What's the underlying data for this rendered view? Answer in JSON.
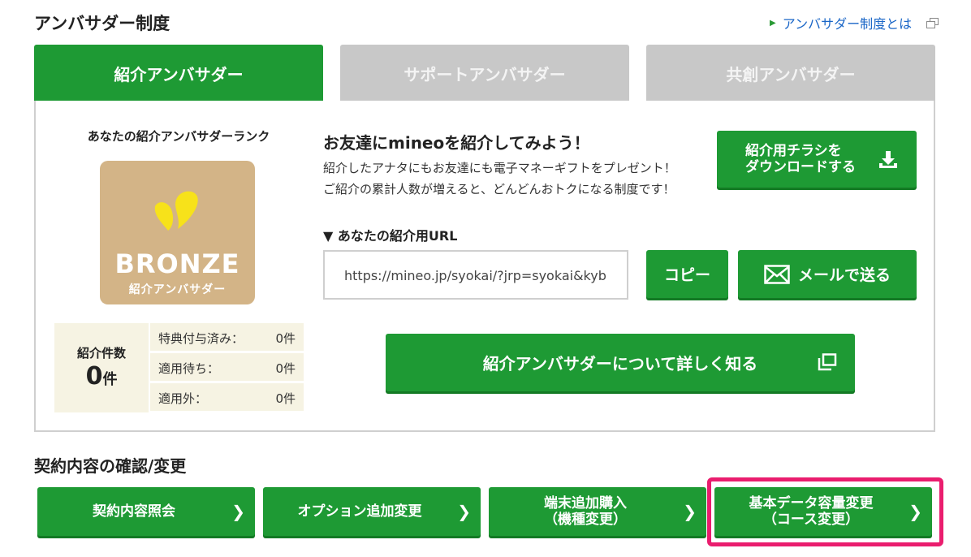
{
  "ambassador": {
    "title": "アンバサダー制度",
    "about_link": "アンバサダー制度とは",
    "tabs": [
      "紹介アンバサダー",
      "サポートアンバサダー",
      "共創アンバサダー"
    ],
    "rank_heading": "あなたの紹介アンバサダーランク",
    "rank_name": "BRONZE",
    "rank_sub": "紹介アンバサダー",
    "count_label": "紹介件数",
    "count_value": "0",
    "count_unit": "件",
    "stats": [
      {
        "label": "特典付与済み：",
        "value": "0件"
      },
      {
        "label": "適用待ち：",
        "value": "0件"
      },
      {
        "label": "適用外：",
        "value": "0件"
      }
    ],
    "promo_heading": "お友達にmineoを紹介してみよう！",
    "promo_line1": "紹介したアナタにもお友達にも電子マネーギフトをプレゼント！",
    "promo_line2": "ご紹介の累計人数が増えると、どんどんおトクになる制度です！",
    "flyer_button_line1": "紹介用チラシを",
    "flyer_button_line2": "ダウンロードする",
    "url_label": "▼ あなたの紹介用URL",
    "url_value": "https://mineo.jp/syokai/?jrp=syokai&kyb",
    "copy_button": "コピー",
    "mail_button": "メールで送る",
    "learn_more_button": "紹介アンバサダーについて詳しく知る"
  },
  "contract": {
    "title": "契約内容の確認/変更",
    "buttons": [
      {
        "line1": "契約内容照会",
        "line2": ""
      },
      {
        "line1": "オプション追加変更",
        "line2": ""
      },
      {
        "line1": "端末追加購入",
        "line2": "（機種変更）"
      },
      {
        "line1": "基本データ容量変更",
        "line2": "（コース変更）"
      }
    ]
  },
  "colors": {
    "primary_green": "#1e9a34",
    "highlight": "#ea1d6e",
    "badge_bronze": "#d3b487"
  }
}
